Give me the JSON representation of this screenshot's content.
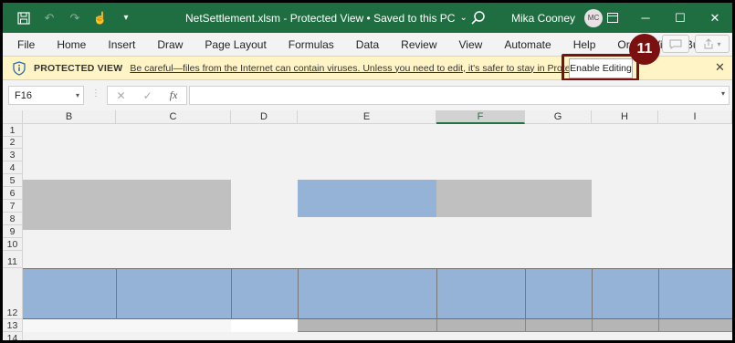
{
  "titlebar": {
    "file_title": "NetSettlement.xlsm",
    "mode": "Protected View",
    "save_status": "Saved to this PC",
    "user_name": "Mika Cooney",
    "user_initials": "MC"
  },
  "ribbon": {
    "tabs": [
      "File",
      "Home",
      "Insert",
      "Draw",
      "Page Layout",
      "Formulas",
      "Data",
      "Review",
      "View",
      "Automate",
      "Help",
      "Oracle Visual Builder"
    ]
  },
  "protected_view": {
    "label": "PROTECTED VIEW",
    "message": "Be careful—files from the Internet can contain viruses. Unless you need to edit, it's safer to stay in Protected View.",
    "enable_button": "Enable Editing",
    "step_badge": "11"
  },
  "formula_bar": {
    "name_box": "F16",
    "fx_label": "fx",
    "formula": ""
  },
  "grid": {
    "columns": [
      "B",
      "C",
      "D",
      "E",
      "F",
      "G",
      "H",
      "I"
    ],
    "selected_column": "F",
    "rows": [
      "1",
      "2",
      "3",
      "4",
      "5",
      "6",
      "7",
      "8",
      "9",
      "10",
      "11",
      "12",
      "13",
      "14"
    ]
  },
  "colors": {
    "titlebar": "#1e6e42",
    "blue_fill": "#95b3d7",
    "gray_fill": "#c0c0c0",
    "highlight": "#7a1010"
  }
}
